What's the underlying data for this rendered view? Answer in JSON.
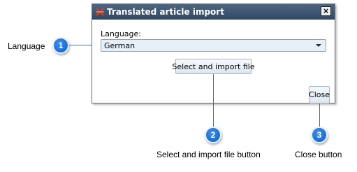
{
  "dialog": {
    "title": "Translated article import",
    "close_glyph": "×",
    "app_icon": "translate-icon",
    "language_label": "Language:",
    "language_value": "German",
    "import_button_label": "Select and import file",
    "close_button_label": "Close"
  },
  "callouts": [
    {
      "number": "1",
      "label": "Language"
    },
    {
      "number": "2",
      "label": "Select and import file button"
    },
    {
      "number": "3",
      "label": "Close button"
    }
  ],
  "colors": {
    "accent": "#1a73e8",
    "titlebar": "#3d5470",
    "combo_bg": "#e6f0f9"
  }
}
